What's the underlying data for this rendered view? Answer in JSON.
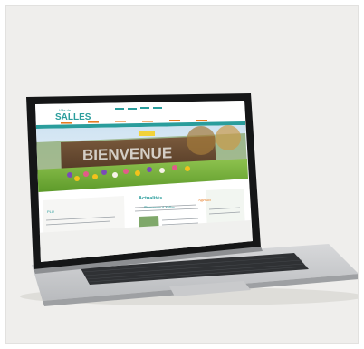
{
  "site": {
    "logo_small": "Ville de",
    "logo_big": "SALLES",
    "banner_text": "BIENVENUE",
    "section_title": "Actualités",
    "article_heading": "Bienvenue à Salles",
    "left_heading": "PLU",
    "agenda_heading": "Agenda",
    "colors": {
      "teal": "#2a9d9c",
      "orange": "#e77b22",
      "green": "#7cb342"
    }
  }
}
